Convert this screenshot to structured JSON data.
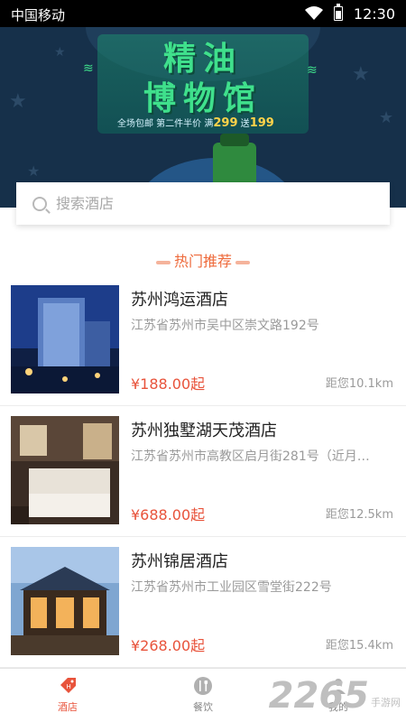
{
  "status_bar": {
    "carrier": "中国移动",
    "time": "12:30"
  },
  "banner": {
    "title_line1": "精油",
    "title_line2": "博物馆",
    "promo_text": "全场包邮  第二件半价  满",
    "promo_amount1": "299",
    "promo_mid": " 送",
    "promo_amount2": "199"
  },
  "search": {
    "placeholder": "搜索酒店"
  },
  "section": {
    "title": "热门推荐"
  },
  "hotels": [
    {
      "name": "苏州鸿运酒店",
      "address": "江苏省苏州市吴中区崇文路192号",
      "price": "¥188.00起",
      "distance": "距您10.1km"
    },
    {
      "name": "苏州独墅湖天茂酒店",
      "address": "江苏省苏州市高教区启月街281号（近月…",
      "price": "¥688.00起",
      "distance": "距您12.5km"
    },
    {
      "name": "苏州锦居酒店",
      "address": "江苏省苏州市工业园区雪堂街222号",
      "price": "¥268.00起",
      "distance": "距您15.4km"
    }
  ],
  "tabs": [
    {
      "label": "酒店",
      "icon": "hotel-tag-icon",
      "active": true
    },
    {
      "label": "餐饮",
      "icon": "cutlery-icon",
      "active": false
    },
    {
      "label": "我的",
      "icon": "user-icon",
      "active": false
    }
  ],
  "watermark": {
    "big": "2265",
    "small": "手游网"
  },
  "colors": {
    "accent": "#e8533b",
    "banner_bg": "#16304a",
    "banner_title": "#3fe08c"
  }
}
